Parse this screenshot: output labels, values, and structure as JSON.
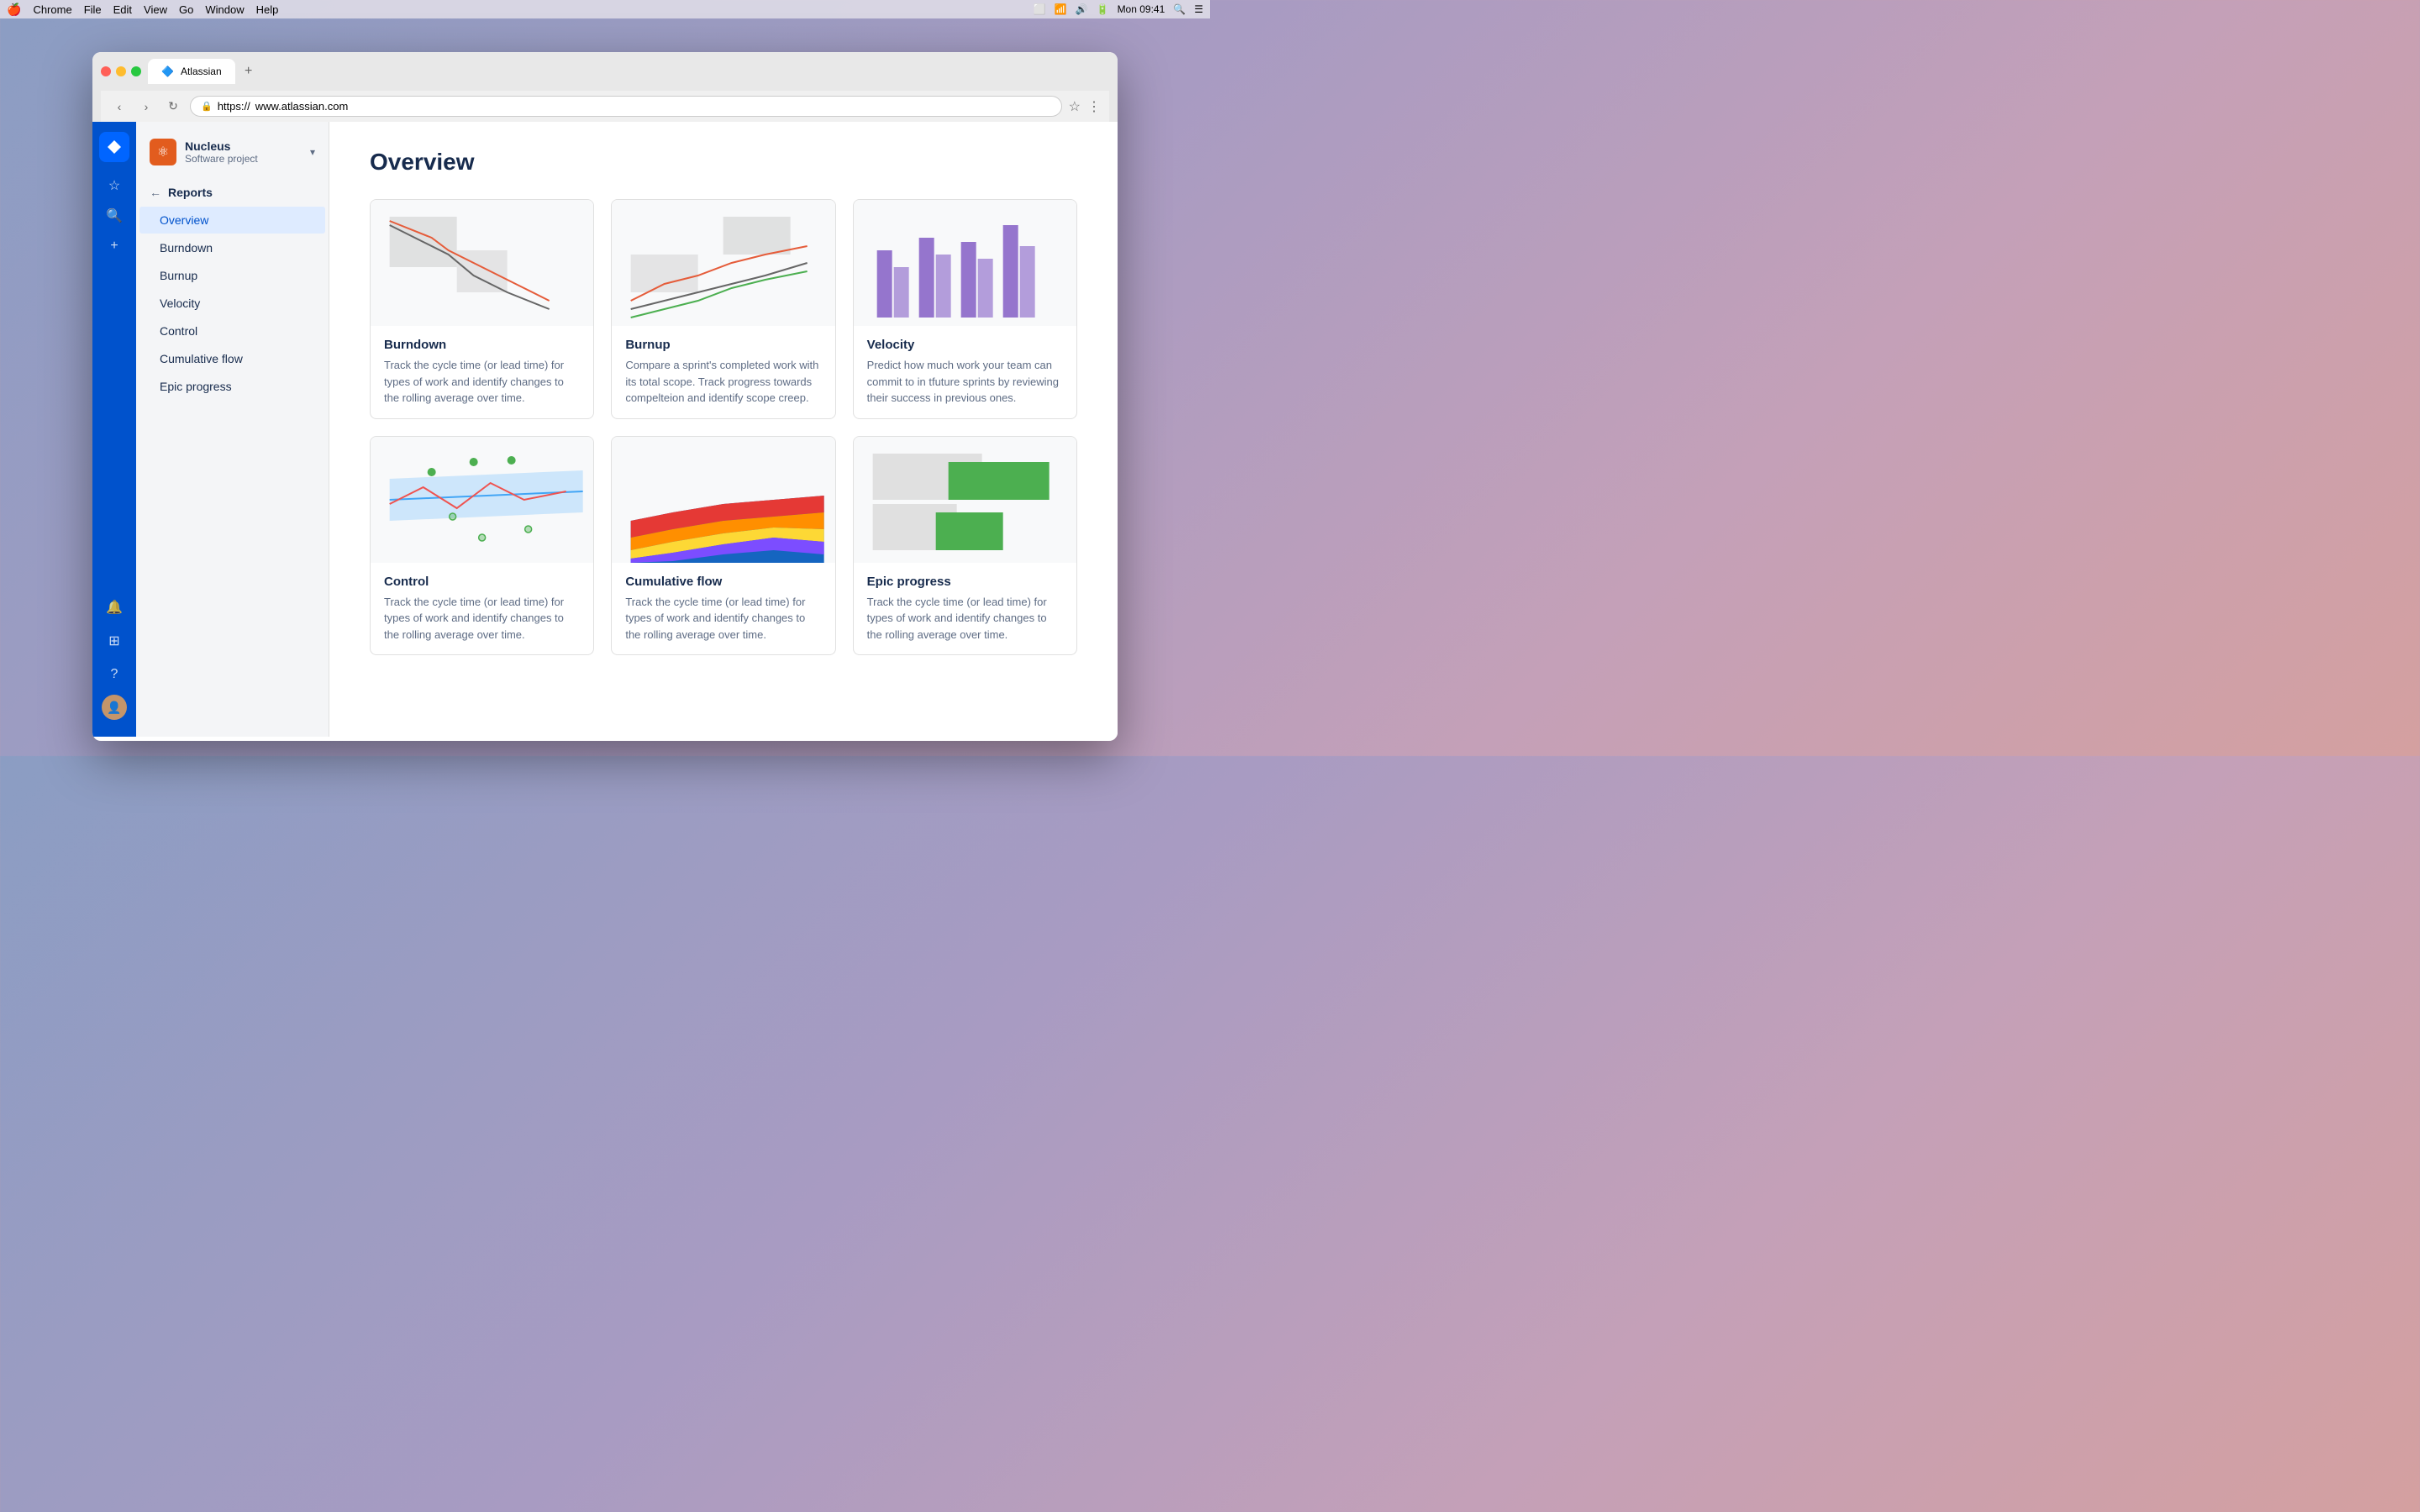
{
  "menubar": {
    "apple": "🍎",
    "items": [
      "Chrome",
      "File",
      "Edit",
      "View",
      "Go",
      "Window",
      "Help"
    ],
    "time": "Mon 09:41"
  },
  "browser": {
    "tab_title": "Atlassian",
    "url_protocol": "https://",
    "url_domain": "www.atlassian.com",
    "new_tab_label": "+"
  },
  "sidebar": {
    "project_name": "Nucleus",
    "project_type": "Software project",
    "project_icon": "⚛",
    "nav_section": "Reports",
    "nav_items": [
      {
        "label": "Overview",
        "active": true
      },
      {
        "label": "Burndown",
        "active": false
      },
      {
        "label": "Burnup",
        "active": false
      },
      {
        "label": "Velocity",
        "active": false
      },
      {
        "label": "Control",
        "active": false
      },
      {
        "label": "Cumulative flow",
        "active": false
      },
      {
        "label": "Epic progress",
        "active": false
      }
    ]
  },
  "main": {
    "title": "Overview",
    "reports": [
      {
        "id": "burndown",
        "title": "Burndown",
        "description": "Track the cycle time (or lead time) for types of work and identify changes to the rolling average over time.",
        "chart_type": "burndown"
      },
      {
        "id": "burnup",
        "title": "Burnup",
        "description": "Compare a sprint's completed work with its total scope. Track progress towards compelteion and identify scope creep.",
        "chart_type": "burnup"
      },
      {
        "id": "velocity",
        "title": "Velocity",
        "description": "Predict how much work your team can commit to in tfuture sprints by reviewing their success in previous ones.",
        "chart_type": "velocity"
      },
      {
        "id": "control",
        "title": "Control",
        "description": "Track the cycle time (or lead time) for types of work and identify changes to the rolling average over time.",
        "chart_type": "control"
      },
      {
        "id": "cumulative_flow",
        "title": "Cumulative flow",
        "description": "Track the cycle time (or lead time) for types of work and identify changes to the rolling average over time.",
        "chart_type": "cumulative_flow"
      },
      {
        "id": "epic_progress",
        "title": "Epic progress",
        "description": "Track the cycle time (or lead time) for types of work and identify changes to the rolling average over time.",
        "chart_type": "epic_progress"
      }
    ]
  }
}
